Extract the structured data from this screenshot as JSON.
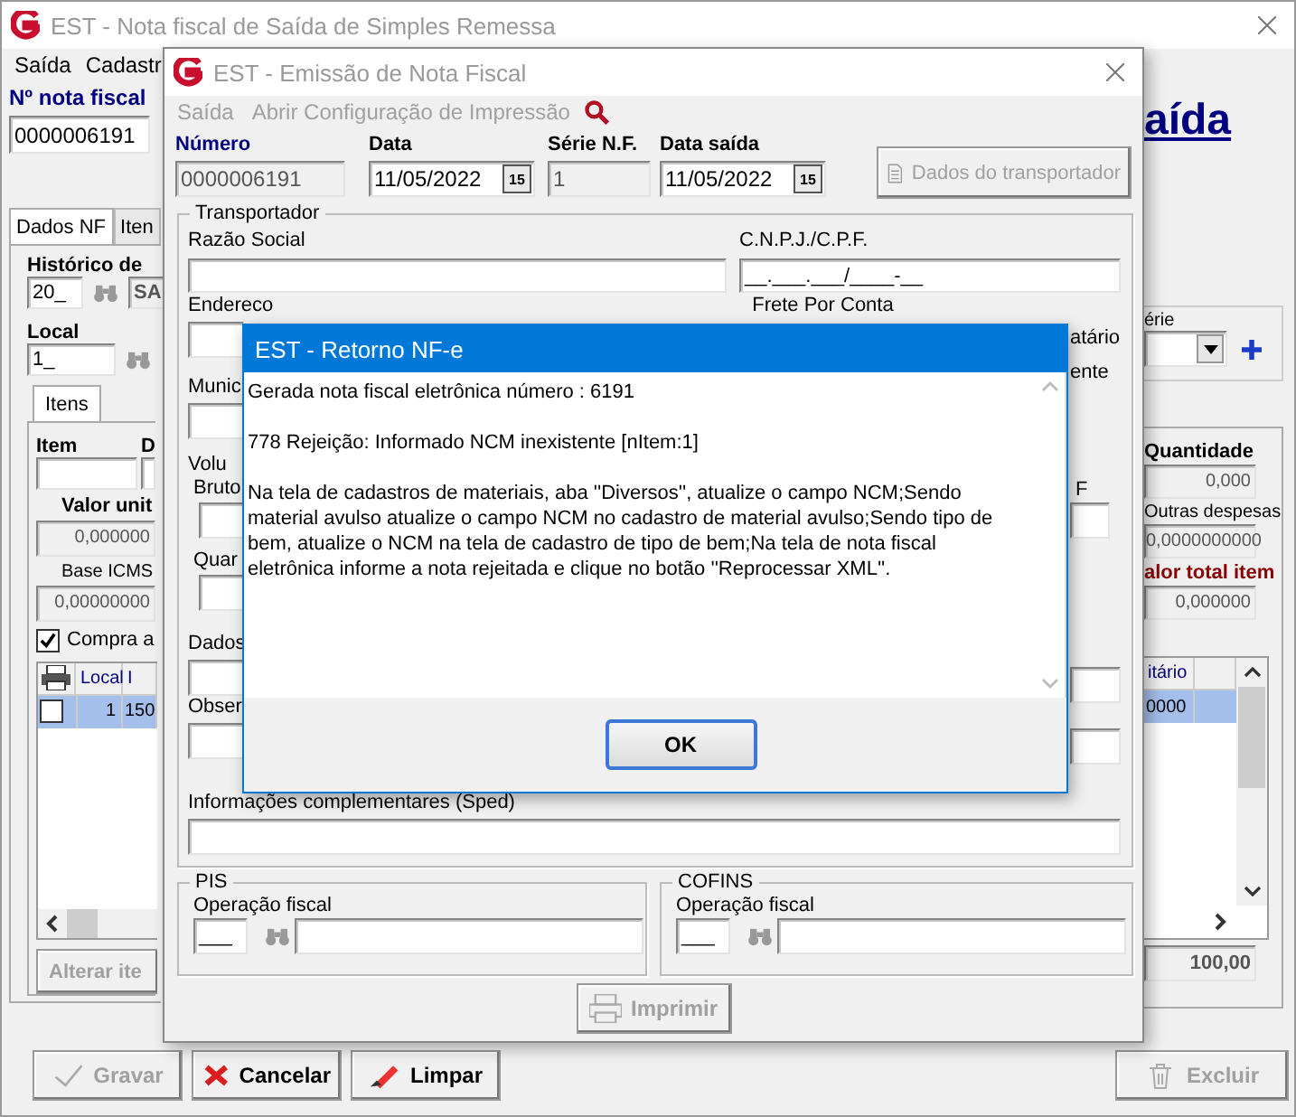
{
  "main_window": {
    "title": "EST - Nota fiscal de Saída de Simples Remessa",
    "menu": [
      "Saída",
      "Cadastr"
    ],
    "invoice_number_label": "Nº nota fiscal",
    "invoice_number": "0000006191",
    "page_link": "aída",
    "tabs": [
      {
        "label": "Dados NF",
        "selected": true
      },
      {
        "label": "Iten",
        "selected": false
      }
    ],
    "history_label": "Histórico de",
    "history_code": "20_",
    "history_name": "SA",
    "local_label": "Local",
    "local_value": "1_",
    "serie_label": "érie",
    "items_tab": {
      "label": "Itens",
      "selected": true
    },
    "item_labels": [
      "Item",
      "D"
    ],
    "left_fields": [
      {
        "label": "Valor unit",
        "value": "0,000000",
        "bold": true
      },
      {
        "label": "Base ICMS",
        "value": "0,00000000",
        "bold": false
      }
    ],
    "right_fields": [
      {
        "label": "Quantidade",
        "value": "0,000",
        "highlight": false
      },
      {
        "label": "Outras despesas",
        "value": "0,0000000000",
        "highlight": false
      },
      {
        "label": "alor total item",
        "value": "0,000000",
        "highlight": true
      }
    ],
    "purchase_checkbox": {
      "label": "Compra a",
      "checked": true
    },
    "grid": {
      "left_columns": [
        "Local",
        "I"
      ],
      "right_columns": [
        "itário"
      ],
      "rows": [
        {
          "selected": true,
          "checked": false,
          "left_cells": [
            "1",
            "150"
          ],
          "right_cells": [
            "0000"
          ]
        }
      ]
    },
    "total": "100,00",
    "edit_item_button": {
      "label": "Alterar ite",
      "disabled": true
    },
    "buttons": [
      {
        "label": "Gravar",
        "disabled": true,
        "kind": "save"
      },
      {
        "label": "Cancelar",
        "disabled": false,
        "kind": "cancel"
      },
      {
        "label": "Limpar",
        "disabled": false,
        "kind": "clear"
      }
    ],
    "delete_button": {
      "label": "Excluir",
      "disabled": true
    }
  },
  "emission_window": {
    "title": "EST - Emissão de Nota Fiscal",
    "menu": [
      {
        "label": "Saída",
        "disabled": true
      },
      {
        "label": "Abrir Configuração de Impressão",
        "disabled": true
      }
    ],
    "header_fields": [
      {
        "label": "Número",
        "value": "0000006191",
        "kind": "readonly"
      },
      {
        "label": "Data",
        "value": "11/05/2022",
        "kind": "date",
        "calendar_button": "15"
      },
      {
        "label": "Série N.F.",
        "value": "1",
        "kind": "readonly"
      },
      {
        "label": "Data saída",
        "value": "11/05/2022",
        "kind": "date",
        "calendar_button": "15"
      }
    ],
    "carrier_button": {
      "label": "Dados do transportador",
      "disabled": true
    },
    "carrier_group": {
      "legend": "Transportador",
      "company_label": "Razão Social",
      "tax_id_label": "C.N.P.J./C.P.F.",
      "tax_id_mask": "__.___.___/____-__",
      "address_label": "Endereco",
      "freight_legend": "Frete Por Conta",
      "freight_options": [
        "atário",
        "ente"
      ],
      "city_label": "Munic",
      "volumes_legend": "Volu",
      "gross_label": "Bruto",
      "quantity_label": "Quar",
      "side_label": "F",
      "data_label": "Dados",
      "notes_label": "Obser",
      "extra_info_label": "Informações complementares (Sped)"
    },
    "pis": {
      "legend": "PIS",
      "label": "Operação fiscal",
      "code": "___"
    },
    "cofins": {
      "legend": "COFINS",
      "label": "Operação fiscal",
      "code": "___"
    },
    "print_button": {
      "label": "Imprimir",
      "disabled": true
    }
  },
  "dialog": {
    "title": "EST - Retorno NF-e",
    "lines": [
      "Gerada nota fiscal eletrônica número : 6191",
      "778 Rejeição: Informado NCM inexistente [nItem:1]",
      "Na tela de cadastros de  materiais, aba ''Diversos'', atualize o campo NCM;Sendo material avulso atualize o campo NCM no cadastro de material avulso;Sendo tipo de bem, atualize o NCM na tela de cadastro de tipo de bem;Na tela de nota fiscal eletrônica informe a nota rejeitada e clique no botão ''Reprocessar XML''."
    ],
    "ok_button": "OK"
  }
}
